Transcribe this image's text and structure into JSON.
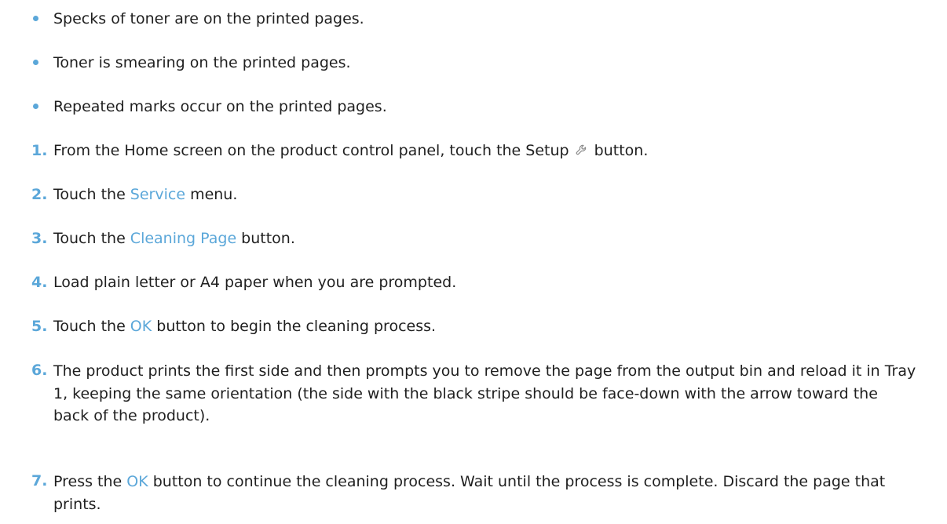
{
  "bullets": [
    "Specks of toner are on the printed pages.",
    "Toner is smearing on the printed pages.",
    "Repeated marks occur on the printed pages."
  ],
  "steps": [
    {
      "num": "1.",
      "before": "From the Home screen on the product control panel, touch the Setup ",
      "icon": "wrench-icon",
      "after": " button."
    },
    {
      "num": "2.",
      "before": "Touch the ",
      "highlight": "Service",
      "after": " menu."
    },
    {
      "num": "3.",
      "before": "Touch the ",
      "highlight": "Cleaning Page",
      "after": " button."
    },
    {
      "num": "4.",
      "before": "Load plain letter or A4 paper when you are prompted."
    },
    {
      "num": "5.",
      "before": "Touch the ",
      "highlight": "OK",
      "after": " button to begin the cleaning process."
    },
    {
      "num": "6.",
      "before": "The product prints the first side and then prompts you to remove the page from the output bin and reload it in Tray 1, keeping the same orientation (the side with the black stripe should be face-down with the arrow toward the back of the product)."
    },
    {
      "num": "7.",
      "before": "Press the ",
      "highlight": "OK",
      "after": " button to continue the cleaning process. Wait until the process is complete. Discard the page that prints."
    }
  ],
  "colors": {
    "accent": "#5ba7d9",
    "text": "#1f1f1f"
  }
}
